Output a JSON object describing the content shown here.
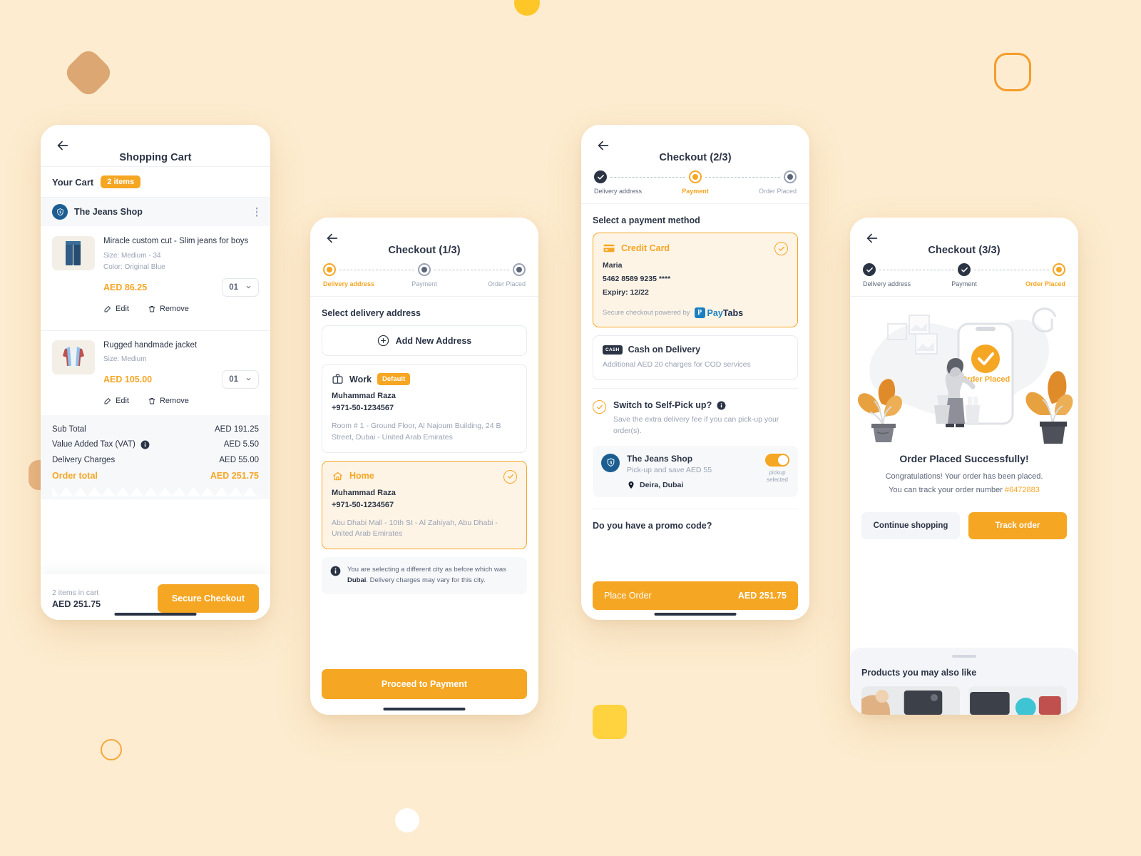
{
  "theme": {
    "accent": "#f5a623",
    "dark": "#2b3445",
    "muted": "#9aa3b5",
    "shop_blue": "#1c5e91",
    "page_bg": "#fdeccf"
  },
  "cart_screen": {
    "title": "Shopping Cart",
    "your_cart_label": "Your Cart",
    "items_chip": "2 items",
    "shop_name": "The Jeans Shop",
    "items": [
      {
        "name": "Miracle custom cut - Slim jeans for boys",
        "size": "Size: Medium - 34",
        "color": "Color: Original Blue",
        "price": "AED 86.25",
        "qty": "01",
        "edit_label": "Edit",
        "remove_label": "Remove"
      },
      {
        "name": "Rugged handmade jacket",
        "size": "Size: Medium",
        "color": "",
        "price": "AED 105.00",
        "qty": "01",
        "edit_label": "Edit",
        "remove_label": "Remove"
      }
    ],
    "summary": [
      {
        "label": "Sub Total",
        "value": "AED 191.25"
      },
      {
        "label": "Value Added Tax (VAT)",
        "value": "AED 5.50"
      },
      {
        "label": "Delivery Charges",
        "value": "AED 55.00"
      }
    ],
    "order_total_label": "Order total",
    "order_total_value": "AED 251.75",
    "footer_items": "2 items in cart",
    "footer_total": "AED 251.75",
    "checkout_button": "Secure Checkout"
  },
  "address_screen": {
    "title": "Checkout (1/3)",
    "steps": [
      {
        "label": "Delivery address",
        "state": "active"
      },
      {
        "label": "Payment",
        "state": "idle"
      },
      {
        "label": "Order Placed",
        "state": "idle"
      }
    ],
    "section_title": "Select delivery address",
    "add_new_label": "Add New Address",
    "addresses": [
      {
        "kind": "Work",
        "badge": "Default",
        "person": "Muhammad Raza",
        "phone": "+971-50-1234567",
        "lines": "Room # 1 - Ground Floor, Al Najoum Building, 24 B Street, Dubai - United Arab Emirates",
        "selected": false
      },
      {
        "kind": "Home",
        "badge": "",
        "person": "Muhammad Raza",
        "phone": "+971-50-1234567",
        "lines": "Abu Dhabi Mall - 10th St - Al Zahiyah, Abu Dhabi - United Arab Emirates",
        "selected": true
      }
    ],
    "note_prefix": "You are selecting a different city as before which was ",
    "note_city": "Dubai",
    "note_suffix": ". Delivery charges may vary for this city.",
    "cta": "Proceed to Payment"
  },
  "payment_screen": {
    "title": "Checkout (2/3)",
    "steps": [
      {
        "label": "Delivery address",
        "state": "done"
      },
      {
        "label": "Payment",
        "state": "active"
      },
      {
        "label": "Order Placed",
        "state": "idle"
      }
    ],
    "section_title": "Select a payment method",
    "credit_card": {
      "name": "Credit Card",
      "holder": "Maria",
      "number": "5462 8589 9235 ****",
      "expiry": "Expiry: 12/22",
      "secure_label": "Secure checkout powered by",
      "provider_mark": "P",
      "provider_name_1": "Pay",
      "provider_name_2": "Tabs"
    },
    "cod": {
      "mark": "CASH",
      "name": "Cash on Delivery",
      "sub": "Additional AED 20 charges for COD services"
    },
    "self_pickup": {
      "title": "Switch to Self-Pick up?",
      "sub": "Save the extra delivery fee if you can pick-up your order(s).",
      "shop_name": "The Jeans Shop",
      "shop_sub": "Pick-up and save AED 55",
      "location": "Deira, Dubai",
      "toggle_caption_1": "pickup",
      "toggle_caption_2": "selected"
    },
    "promo_title": "Do you have a promo code?",
    "place_order_label": "Place Order",
    "place_order_amount": "AED 251.75"
  },
  "success_screen": {
    "title": "Checkout (3/3)",
    "steps": [
      {
        "label": "Delivery address",
        "state": "done"
      },
      {
        "label": "Payment",
        "state": "done"
      },
      {
        "label": "Order Placed",
        "state": "active"
      }
    ],
    "illustration_badge": "Order Placed",
    "heading": "Order Placed Successfully!",
    "message_line1": "Congratulations! Your order has been placed.",
    "message_line2": "You can track your order number ",
    "order_number": "#6472883",
    "continue_label": "Continue shopping",
    "track_label": "Track order",
    "sheet_title": "Products you may also like"
  }
}
